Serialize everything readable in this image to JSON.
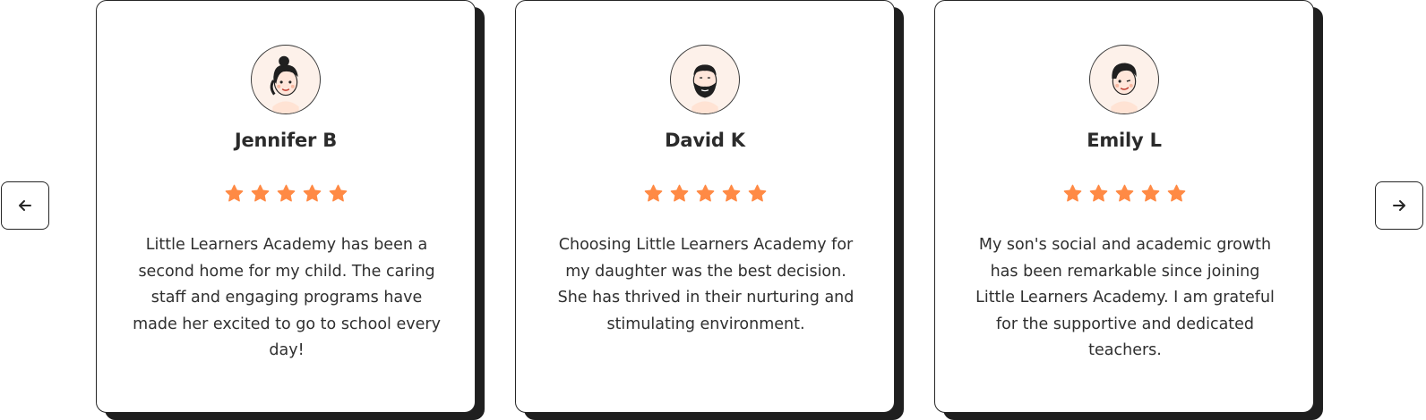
{
  "testimonials": [
    {
      "name": "Jennifer B",
      "rating": 5,
      "quote": "Little Learners Academy has been a second home for my child. The caring staff and engaging programs have made her excited to go to school every day!",
      "avatar_icon": "girl-avatar-icon"
    },
    {
      "name": "David K",
      "rating": 5,
      "quote": "Choosing Little Learners Academy for my daughter was the best decision. She has thrived in their nurturing and stimulating environment.",
      "avatar_icon": "bearded-man-avatar-icon"
    },
    {
      "name": "Emily L",
      "rating": 5,
      "quote": "My son's social and academic growth has been remarkable since joining Little Learners Academy. I am grateful for the supportive and dedicated teachers.",
      "avatar_icon": "woman-avatar-icon"
    }
  ],
  "navigation": {
    "prev_icon": "arrow-left-icon",
    "next_icon": "arrow-right-icon"
  },
  "colors": {
    "star": "#ff8a45",
    "card_border": "#262626",
    "card_shadow": "#1f1f1f",
    "avatar_bg": "#fdf1ea",
    "text": "#2f2f2f"
  }
}
